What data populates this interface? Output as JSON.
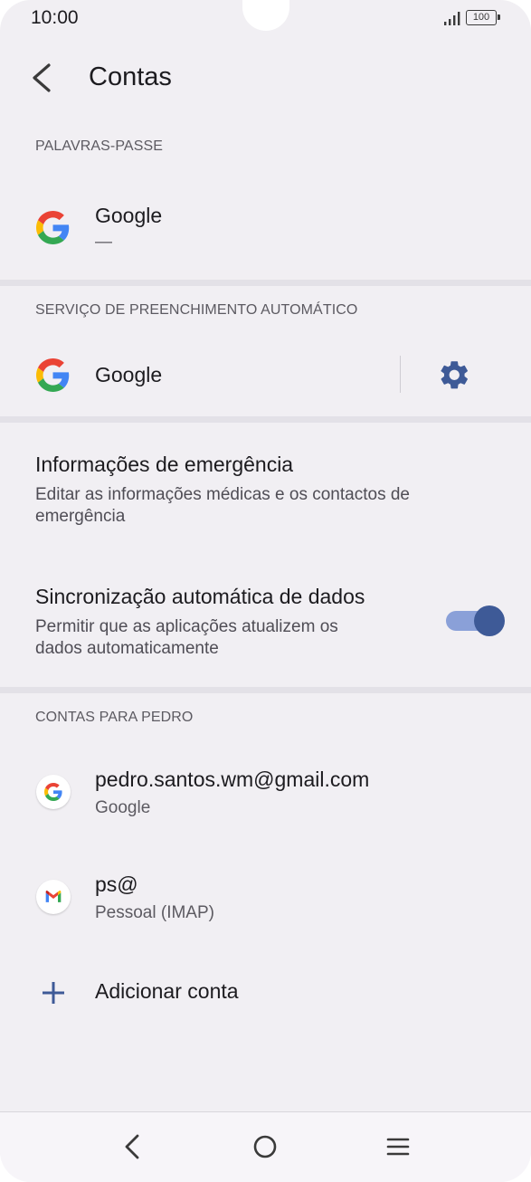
{
  "status_bar": {
    "time": "10:00",
    "battery": "100",
    "signal_icon": "signal-icon",
    "battery_icon": "battery-icon"
  },
  "header": {
    "title": "Contas",
    "back_icon": "back-arrow-icon"
  },
  "passwords_section": {
    "label": "PALAVRAS-PASSE",
    "item": {
      "title": "Google",
      "subtitle": "—",
      "icon": "google-g-icon"
    }
  },
  "autofill_section": {
    "label": "SERVIÇO DE PREENCHIMENTO AUTOMÁTICO",
    "item": {
      "title": "Google",
      "icon": "google-g-icon",
      "settings_icon": "gear-icon"
    }
  },
  "emergency": {
    "title": "Informações de emergência",
    "subtitle_line1": "Editar as informações médicas e os contactos de",
    "subtitle_line2": "emergência"
  },
  "auto_sync": {
    "title": "Sincronização automática de dados",
    "subtitle_line1": "Permitir que as aplicações atualizem os",
    "subtitle_line2": "dados automaticamente",
    "enabled": true,
    "accent_color": "#3e5a97"
  },
  "accounts_section": {
    "label": "CONTAS PARA PEDRO",
    "accounts": [
      {
        "title": "pedro.santos.wm@gmail.com",
        "subtitle": "Google",
        "icon": "google-g-icon"
      },
      {
        "title": "ps@",
        "subtitle": "Pessoal (IMAP)",
        "icon": "gmail-icon"
      }
    ],
    "add_label": "Adicionar conta",
    "add_icon": "plus-icon"
  },
  "nav_bar": {
    "back_icon": "nav-back-icon",
    "home_icon": "nav-home-icon",
    "menu_icon": "nav-menu-icon"
  }
}
